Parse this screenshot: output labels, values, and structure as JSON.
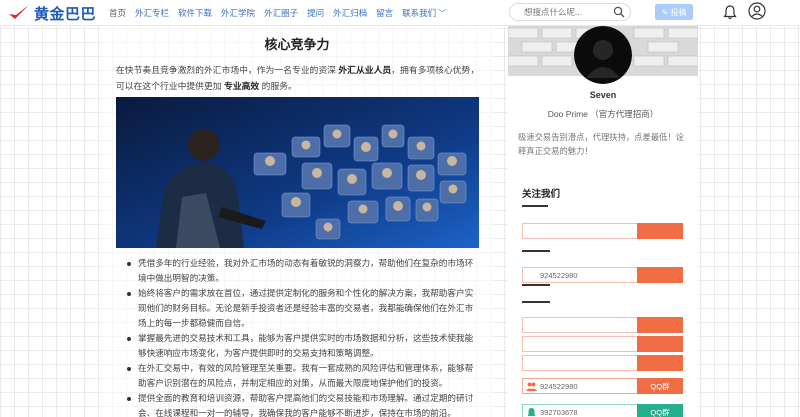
{
  "header": {
    "logo_text": "黄金巴巴",
    "nav": [
      {
        "label": "首页",
        "name": "nav-home"
      },
      {
        "label": "外汇专栏",
        "name": "nav-forex-column"
      },
      {
        "label": "软件下载",
        "name": "nav-software-download"
      },
      {
        "label": "外汇学院",
        "name": "nav-forex-academy"
      },
      {
        "label": "外汇圈子",
        "name": "nav-forex-circle"
      },
      {
        "label": "提问",
        "name": "nav-ask"
      },
      {
        "label": "外汇归档",
        "name": "nav-forex-archive"
      },
      {
        "label": "留言",
        "name": "nav-message"
      },
      {
        "label": "联系我们",
        "name": "nav-contact"
      }
    ],
    "search_placeholder": "想搜点什么呢...",
    "post_button": "✎ 投稿"
  },
  "article": {
    "title": "核心竞争力",
    "intro_1": "在快节奏且竞争激烈的外汇市场中，作为一名专业的资深 ",
    "intro_bold_1": "外汇从业人员",
    "intro_2": "，拥有多项核心优势，可以在这个行业中提供更加 ",
    "intro_bold_2": "专业高效",
    "intro_3": " 的服务。",
    "bullets": [
      "凭借多年的行业经验，我对外汇市场的动态有着敏锐的洞察力，帮助他们在复杂的市场环境中做出明智的决策。",
      "始终将客户的需求放在首位，通过提供定制化的服务和个性化的解决方案，我帮助客户实现他们的财务目标。无论是新手投资者还是经验丰富的交易者，我都能确保他们在外汇市场上的每一步都稳健而自信。",
      "掌握最先进的交易技术和工具，能够为客户提供实时的市场数据和分析，这些技术使我能够快速响应市场变化，为客户提供即时的交易支持和策略调整。",
      "在外汇交易中，有效的风险管理至关重要。我有一套成熟的风险评估和管理体系，能够帮助客户识别潜在的风险点，并制定相应的对策，从而最大限度地保护他们的投资。",
      "提供全面的教育和培训资源，帮助客户提高他们的交易技能和市场理解。通过定期的研讨会、在线课程和一对一的辅导，我确保我的客户能够不断进步，保持在市场的前沿。"
    ]
  },
  "sidebar": {
    "name": "Seven",
    "title": "Doo Prime （官方代理招商）",
    "bio": "极速交易告别滑点，代理扶持，点差最低！诠释真正交易的魅力！",
    "contact_heading": "关注我们",
    "contacts": [
      {
        "value": "",
        "button": ""
      },
      {
        "value": "",
        "button": ""
      },
      {
        "value": "924522980",
        "button": ""
      },
      {
        "value": "",
        "button": ""
      },
      {
        "value": "",
        "button": ""
      },
      {
        "value": "",
        "button": ""
      },
      {
        "value": "924522980",
        "button": "QQ群"
      },
      {
        "value": "392703678",
        "button": "QQ群"
      }
    ]
  },
  "colors": {
    "brand_blue": "#1e5bb8",
    "nav_blue": "#3a6fc6",
    "accent_orange": "#ef6c45",
    "accent_teal": "#23b08c",
    "post_button_bg": "#a9cdf8"
  }
}
